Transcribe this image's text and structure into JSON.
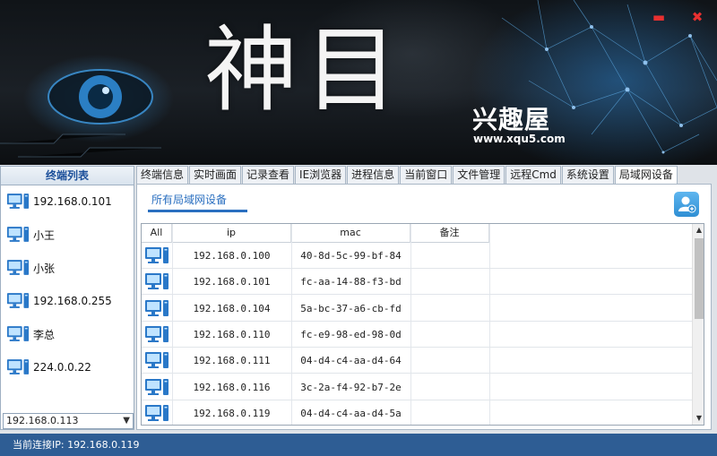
{
  "app": {
    "title": "神目",
    "brand_name": "兴趣屋",
    "brand_url": "www.xqu5.com",
    "min_icon": "minimize-icon",
    "close_icon": "close-icon"
  },
  "colors": {
    "accent": "#2a6fc0",
    "statusbar": "#2e5d94",
    "window_buttons": "#e83030"
  },
  "sidebar": {
    "header": "终端列表",
    "items": [
      {
        "label": "192.168.0.101",
        "icon": "computer-icon"
      },
      {
        "label": "小王",
        "icon": "computer-icon"
      },
      {
        "label": "小张",
        "icon": "computer-icon"
      },
      {
        "label": "192.168.0.255",
        "icon": "computer-icon"
      },
      {
        "label": "李总",
        "icon": "computer-icon"
      },
      {
        "label": "224.0.0.22",
        "icon": "computer-icon"
      }
    ],
    "selected_ip": "192.168.0.113"
  },
  "tabs": [
    {
      "label": "终端信息",
      "active": false
    },
    {
      "label": "实时画面",
      "active": false
    },
    {
      "label": "记录查看",
      "active": false
    },
    {
      "label": "IE浏览器",
      "active": false
    },
    {
      "label": "进程信息",
      "active": false
    },
    {
      "label": "当前窗口",
      "active": false
    },
    {
      "label": "文件管理",
      "active": false
    },
    {
      "label": "远程Cmd",
      "active": false
    },
    {
      "label": "系统设置",
      "active": false
    },
    {
      "label": "局域网设备",
      "active": true
    }
  ],
  "lan_panel": {
    "subtab": "所有局域网设备",
    "add_icon": "add-user-icon",
    "columns": [
      "All",
      "ip",
      "mac",
      "备注"
    ],
    "rows": [
      {
        "ip": "192.168.0.100",
        "mac": "40-8d-5c-99-bf-84",
        "note": ""
      },
      {
        "ip": "192.168.0.101",
        "mac": "fc-aa-14-88-f3-bd",
        "note": ""
      },
      {
        "ip": "192.168.0.104",
        "mac": "5a-bc-37-a6-cb-fd",
        "note": ""
      },
      {
        "ip": "192.168.0.110",
        "mac": "fc-e9-98-ed-98-0d",
        "note": ""
      },
      {
        "ip": "192.168.0.111",
        "mac": "04-d4-c4-aa-d4-64",
        "note": ""
      },
      {
        "ip": "192.168.0.116",
        "mac": "3c-2a-f4-92-b7-2e",
        "note": ""
      },
      {
        "ip": "192.168.0.119",
        "mac": "04-d4-c4-aa-d4-5a",
        "note": ""
      }
    ]
  },
  "status": {
    "text": "当前连接IP: 192.168.0.119"
  }
}
